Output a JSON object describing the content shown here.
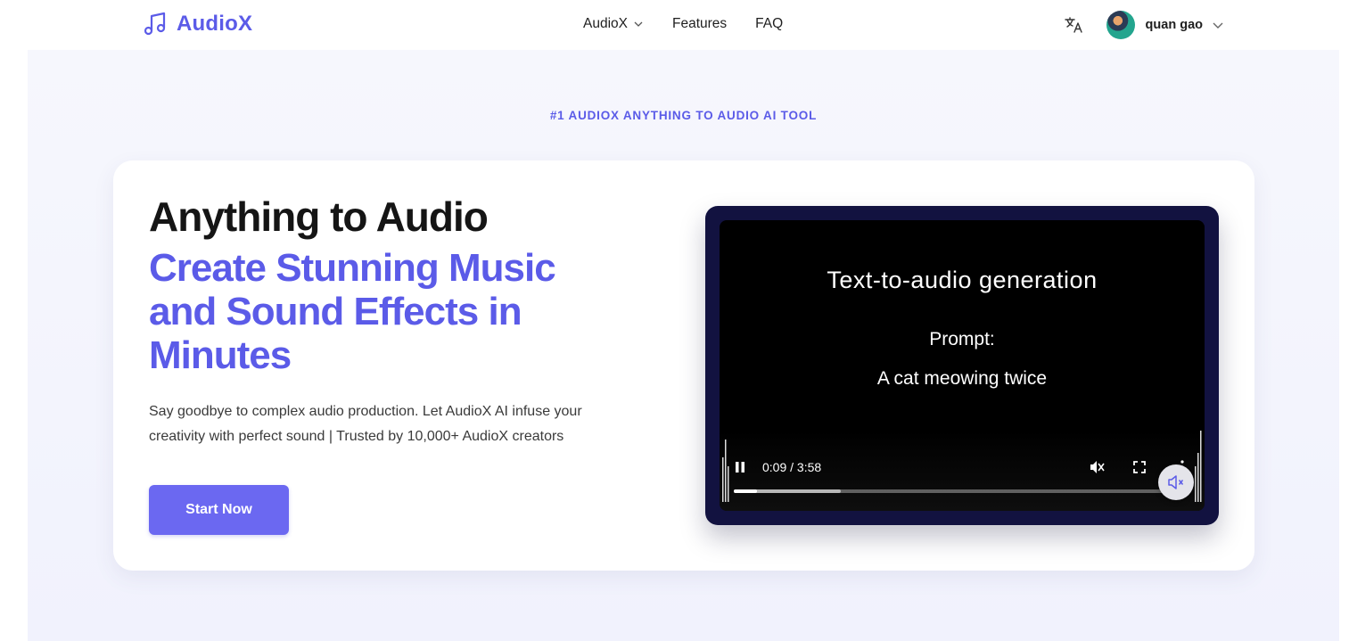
{
  "header": {
    "logo_text": "AudioX",
    "nav": [
      {
        "label": "AudioX",
        "has_dropdown": true
      },
      {
        "label": "Features",
        "has_dropdown": false
      },
      {
        "label": "FAQ",
        "has_dropdown": false
      }
    ],
    "user": {
      "name": "quan gao"
    },
    "icons": {
      "logo": "music-note-icon",
      "translate": "translate-icon",
      "user_menu": "chevron-down-icon"
    }
  },
  "hero": {
    "eyebrow": "#1 AUDIOX ANYTHING TO AUDIO AI TOOL",
    "title": "Anything to Audio",
    "subtitle": "Create Stunning Music and Sound Effects in Minutes",
    "description": "Say goodbye to complex audio production. Let AudioX AI infuse your creativity with perfect sound | Trusted by 10,000+ AudioX creators",
    "cta_label": "Start Now"
  },
  "video": {
    "heading": "Text-to-audio generation",
    "prompt_label": "Prompt:",
    "prompt_text": "A cat meowing twice",
    "time_display": "0:09 / 3:58",
    "progress_played": 0.052,
    "progress_buffered": 0.24,
    "state": "playing",
    "muted": true
  },
  "colors": {
    "brand": "#5b5be8",
    "cta": "#6b68f1",
    "video_frame": "#121240"
  }
}
